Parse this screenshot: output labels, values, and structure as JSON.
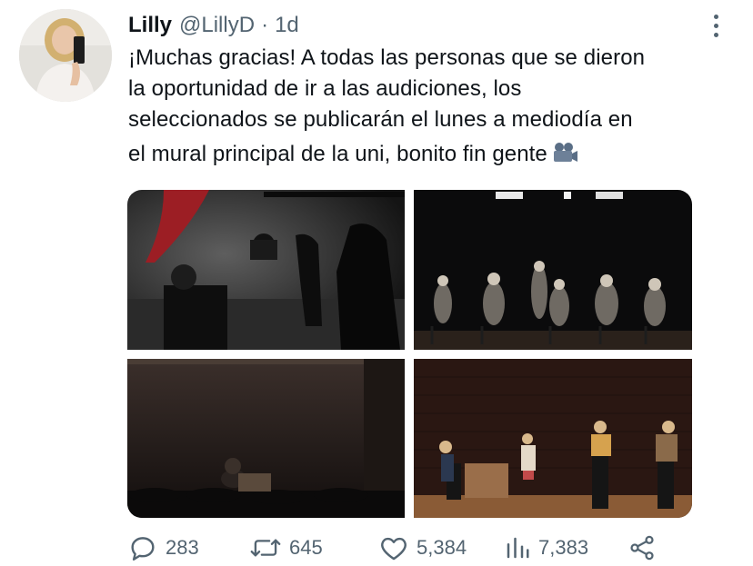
{
  "tweet": {
    "author_name": "Lilly",
    "handle": "@LillyD",
    "separator": "·",
    "time": "1d",
    "text_lines": [
      "¡Muchas gracias! A todas las personas que se dieron",
      "la oportunidad de ir a las audiciones, los",
      "seleccionados se publicarán el lunes a mediodía en",
      "el mural principal de la uni, bonito fin gente"
    ],
    "emoji": "movie-camera-emoji"
  },
  "media": {
    "photos": [
      {
        "subject": "film-set-silhouettes"
      },
      {
        "subject": "table-read-on-stage"
      },
      {
        "subject": "person-in-theater-seats"
      },
      {
        "subject": "stage-rehearsal-with-scripts"
      }
    ]
  },
  "actions": {
    "reply": "283",
    "retweet": "645",
    "like": "5,384",
    "views": "7,383"
  },
  "colors": {
    "text": "#0f1419",
    "secondary": "#536471"
  }
}
